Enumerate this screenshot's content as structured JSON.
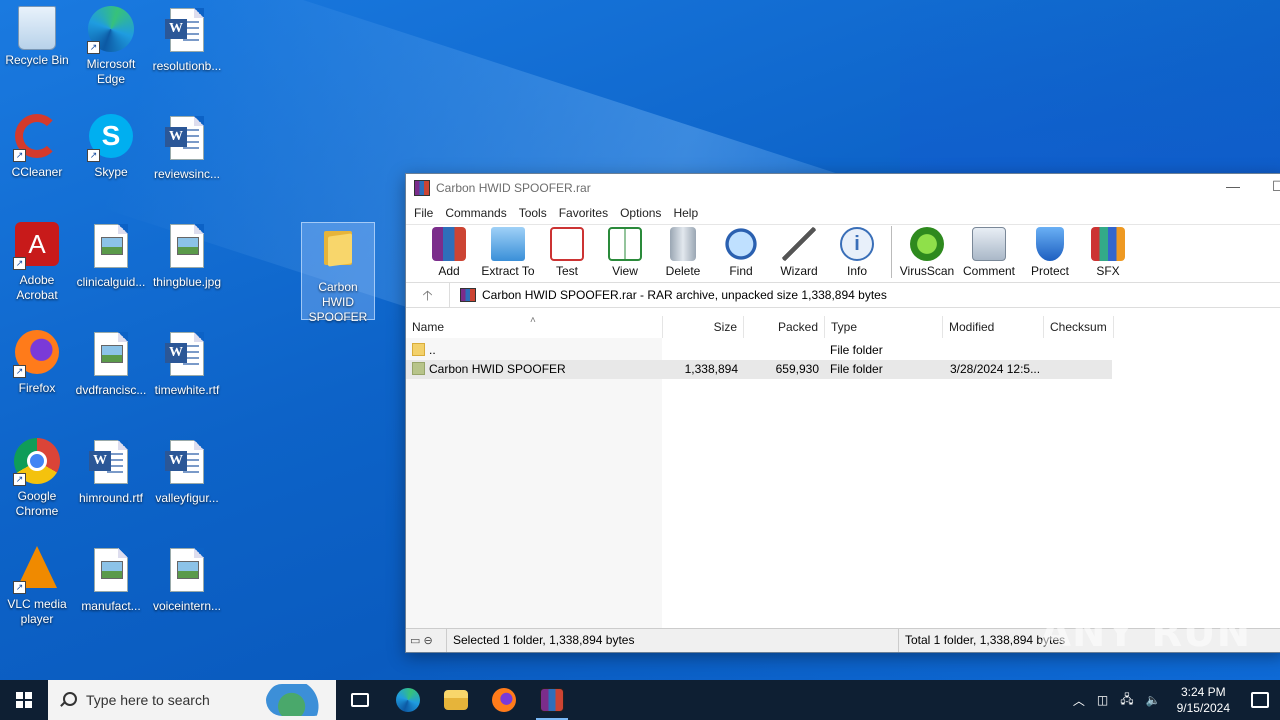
{
  "desktop": {
    "icons": [
      {
        "label": "Recycle Bin"
      },
      {
        "label": "Microsoft Edge"
      },
      {
        "label": "resolutionb..."
      },
      {
        "label": "CCleaner"
      },
      {
        "label": "Skype"
      },
      {
        "label": "reviewsinc..."
      },
      {
        "label": "Adobe Acrobat"
      },
      {
        "label": "clinicalguid..."
      },
      {
        "label": "thingblue.jpg"
      },
      {
        "label": "Carbon HWID SPOOFER"
      },
      {
        "label": "Firefox"
      },
      {
        "label": "dvdfrancisc..."
      },
      {
        "label": "timewhite.rtf"
      },
      {
        "label": "Google Chrome"
      },
      {
        "label": "himround.rtf"
      },
      {
        "label": "valleyfigur..."
      },
      {
        "label": "VLC media player"
      },
      {
        "label": "manufact..."
      },
      {
        "label": "voiceintern..."
      }
    ]
  },
  "window": {
    "title": "Carbon HWID SPOOFER.rar",
    "menu": [
      "File",
      "Commands",
      "Tools",
      "Favorites",
      "Options",
      "Help"
    ],
    "toolbar": [
      "Add",
      "Extract To",
      "Test",
      "View",
      "Delete",
      "Find",
      "Wizard",
      "Info",
      "VirusScan",
      "Comment",
      "Protect",
      "SFX"
    ],
    "address": "Carbon HWID SPOOFER.rar - RAR archive, unpacked size 1,338,894 bytes",
    "columns": {
      "name": "Name",
      "size": "Size",
      "packed": "Packed",
      "type": "Type",
      "modified": "Modified",
      "checksum": "Checksum"
    },
    "rows": [
      {
        "name": "..",
        "size": "",
        "packed": "",
        "type": "File folder",
        "modified": "",
        "checksum": ""
      },
      {
        "name": "Carbon HWID SPOOFER",
        "size": "1,338,894",
        "packed": "659,930",
        "type": "File folder",
        "modified": "3/28/2024 12:5...",
        "checksum": ""
      }
    ],
    "status_selected": "Selected 1 folder, 1,338,894 bytes",
    "status_total": "Total 1 folder, 1,338,894 bytes"
  },
  "watermark": "ANY RUN",
  "taskbar": {
    "search_placeholder": "Type here to search",
    "time": "3:24 PM",
    "date": "9/15/2024"
  },
  "colors": {
    "desktop": "#0d63c8",
    "taskbar": "#0e1f33",
    "accent": "#7ab8f5"
  }
}
